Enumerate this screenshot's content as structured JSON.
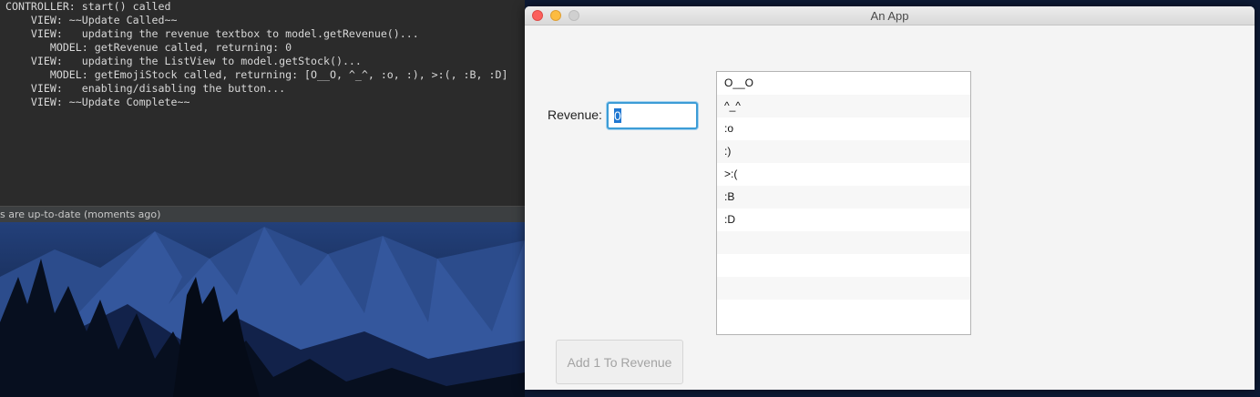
{
  "console": {
    "lines": [
      "CONTROLLER: start() called",
      "    VIEW: ~~Update Called~~",
      "    VIEW:   updating the revenue textbox to model.getRevenue()...",
      "       MODEL: getRevenue called, returning: 0",
      "    VIEW:   updating the ListView to model.getStock()...",
      "       MODEL: getEmojiStock called, returning: [O__O, ^_^, :o, :), >:(, :B, :D]",
      "    VIEW:   enabling/disabling the button...",
      "    VIEW: ~~Update Complete~~"
    ],
    "status_text": "s are up-to-date (moments ago)"
  },
  "window": {
    "title": "An App",
    "revenue_label": "Revenue:",
    "revenue_value": "0",
    "list_items": [
      "O__O",
      "^_^",
      ":o",
      ":)",
      ">:(",
      ":B",
      ":D"
    ],
    "empty_rows": 4,
    "add_button_label": "Add 1 To Revenue",
    "add_button_disabled": true
  },
  "colors": {
    "console_bg": "#2b2b2b",
    "console_text": "#d8d8d8",
    "focus_ring": "#3c9cd6",
    "close": "#fc605c",
    "minimize": "#fdbc40"
  }
}
